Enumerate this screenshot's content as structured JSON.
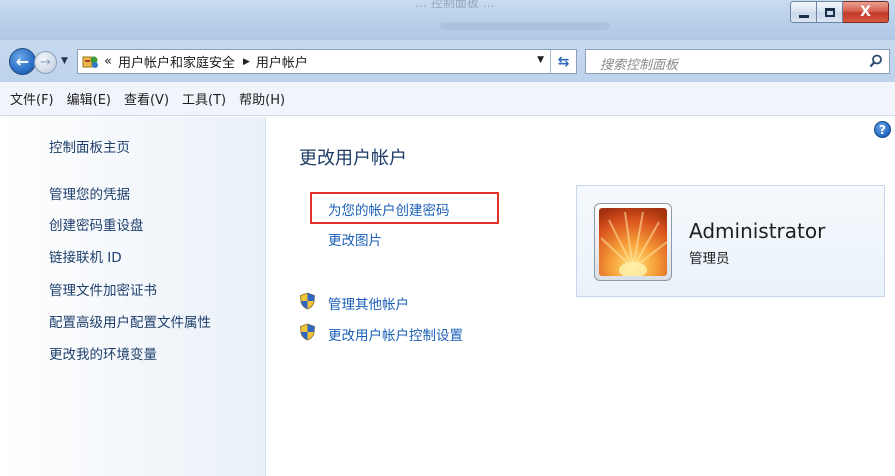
{
  "window": {
    "ghost_title": "… 控制面板 …",
    "caption_close_label": "X"
  },
  "address_bar": {
    "overflow_marker": "«",
    "breadcrumbs": [
      "用户帐户和家庭安全",
      "用户帐户"
    ]
  },
  "search": {
    "placeholder": "搜索控制面板"
  },
  "menubar": {
    "items": [
      "文件(F)",
      "编辑(E)",
      "查看(V)",
      "工具(T)",
      "帮助(H)"
    ]
  },
  "sidebar": {
    "home": "控制面板主页",
    "links": [
      "管理您的凭据",
      "创建密码重设盘",
      "链接联机 ID",
      "管理文件加密证书",
      "配置高级用户配置文件属性",
      "更改我的环境变量"
    ]
  },
  "main": {
    "title": "更改用户帐户",
    "tasks": [
      "为您的帐户创建密码",
      "更改图片"
    ],
    "shield_tasks": [
      "管理其他帐户",
      "更改用户帐户控制设置"
    ],
    "help_label": "?"
  },
  "account": {
    "name": "Administrator",
    "role": "管理员"
  },
  "colors": {
    "link": "#1b5fb8",
    "title": "#1f3c67",
    "highlight_box": "#e0302c"
  }
}
